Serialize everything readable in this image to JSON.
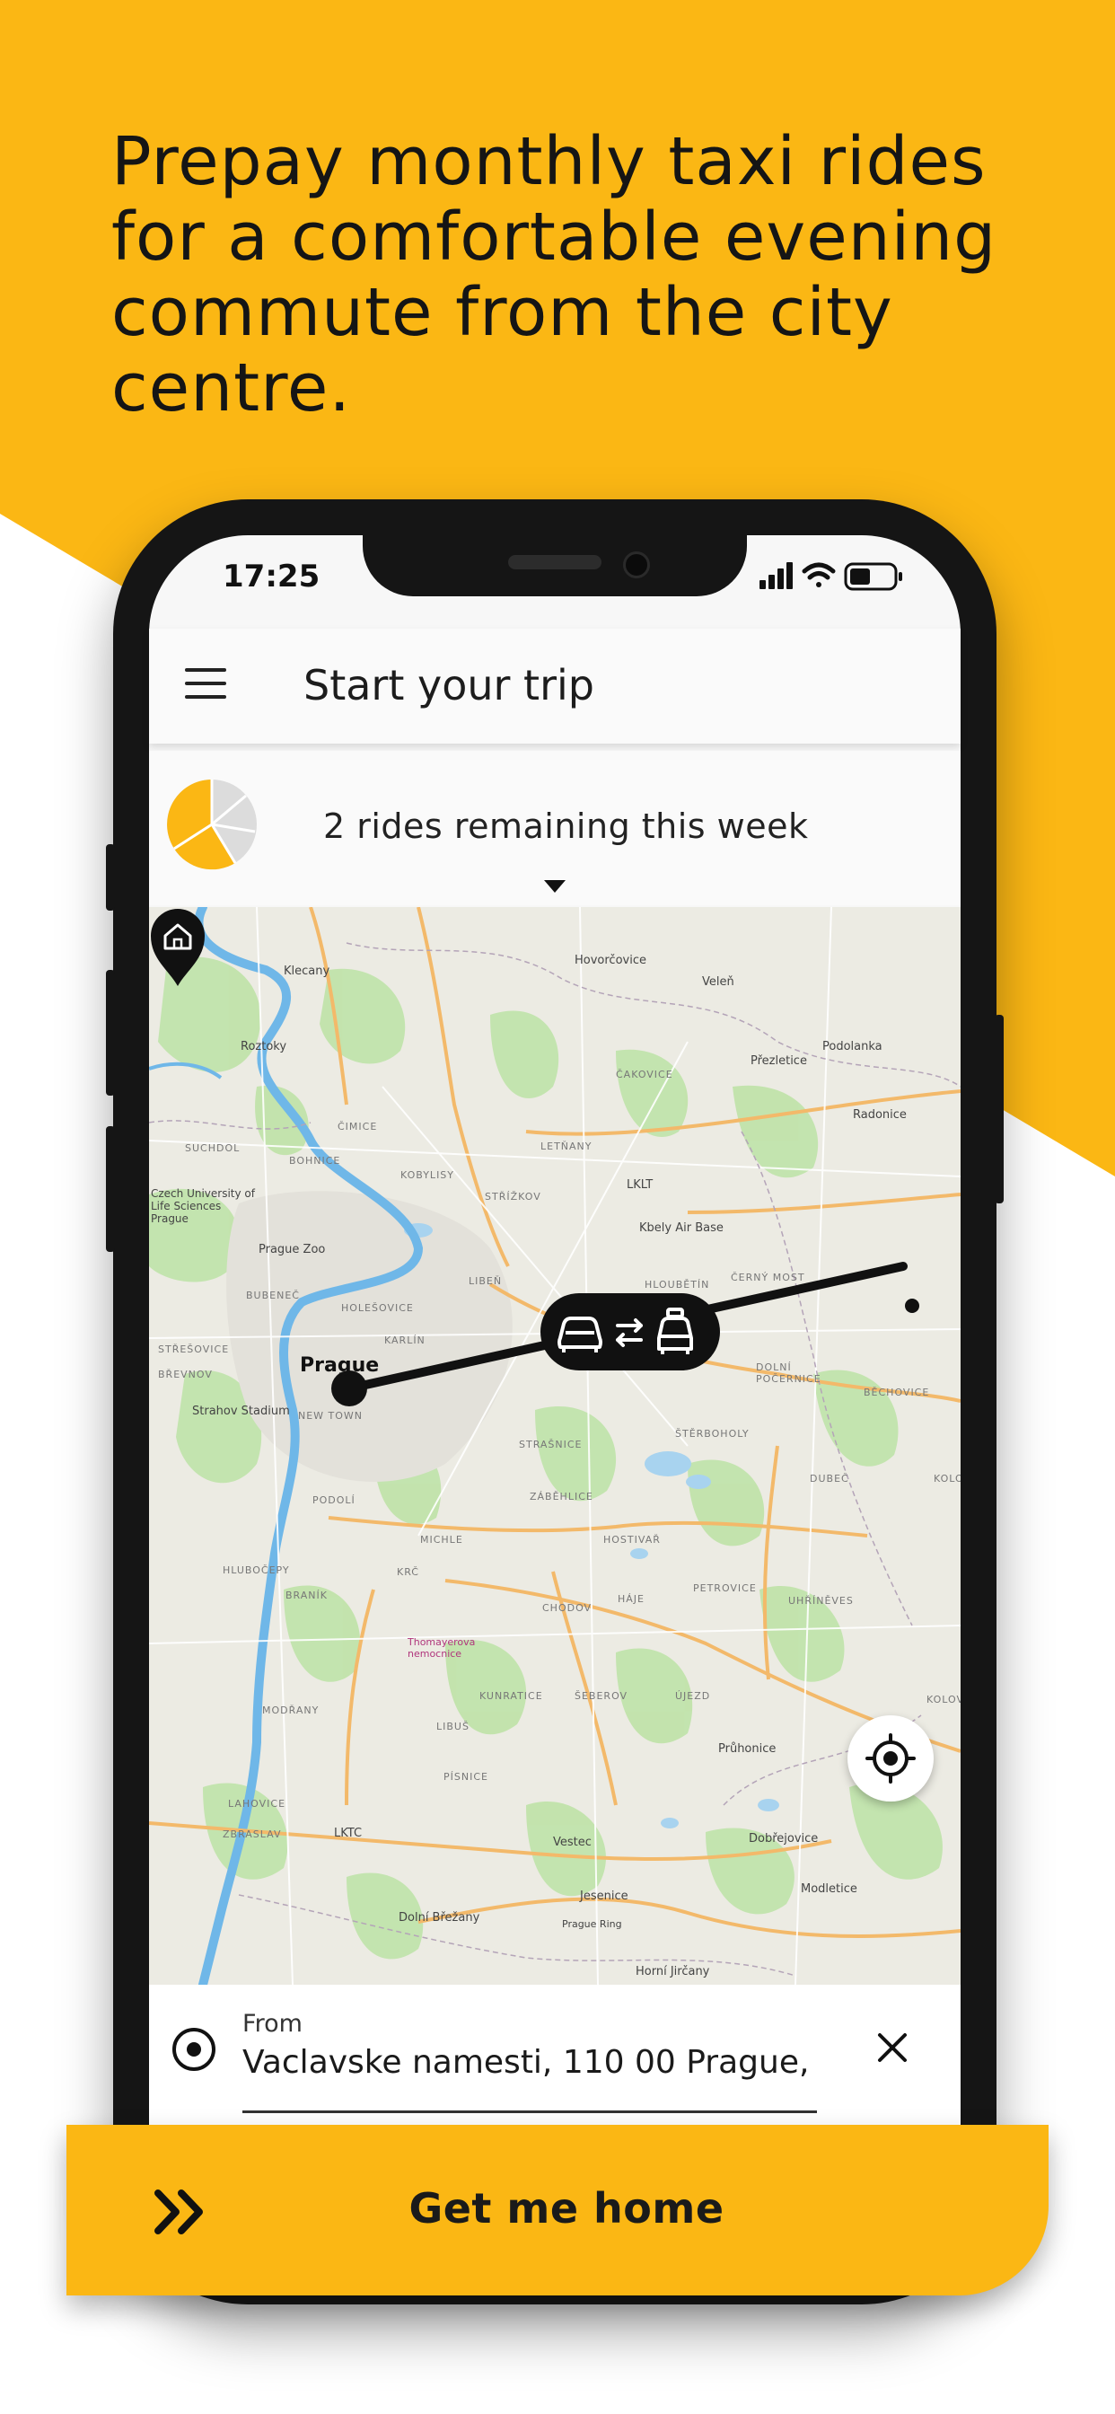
{
  "promo": {
    "headline": "Prepay monthly taxi rides for a comfortable evening commute from the city centre.",
    "background_color": "#fbb714"
  },
  "status_bar": {
    "time": "17:25",
    "icons": [
      "cellular-signal-icon",
      "wifi-icon",
      "battery-icon"
    ]
  },
  "header": {
    "menu_icon": "hamburger-menu-icon",
    "title": "Start your trip"
  },
  "rides": {
    "text": "2 rides remaining this week",
    "remaining_fraction": 0.4,
    "accent_color": "#fbb714"
  },
  "map": {
    "city_label": "Prague",
    "labels": {
      "klecany": "Klecany",
      "hovorcovice": "Hovorčovice",
      "velen": "Veleň",
      "roztoky": "Roztoky",
      "podolanka": "Podolanka",
      "prezletice": "Přezletice",
      "radonice": "Radonice",
      "cakovice": "ČAKOVICE",
      "cimice": "ČIMICE",
      "letnany": "LETŇANY",
      "bohnice": "BOHNICE",
      "suchdol": "SUCHDOL",
      "kobylisy": "KOBYLISY",
      "strizkov": "STŘÍŽKOV",
      "lklt": "LKLT",
      "czu": "Czech University of Life Sciences Prague",
      "kbely": "Kbely Air Base",
      "prague_zoo": "Prague Zoo",
      "bubenec": "BUBENEČ",
      "holesovice": "HOLEŠOVICE",
      "liben": "LIBEŇ",
      "hloubetin": "HLOUBĚTÍN",
      "cerny_most": "ČERNÝ MOST",
      "karlin": "KARLÍN",
      "strešovice": "STŘEŠOVICE",
      "brevnov": "BŘEVNOV",
      "strahov": "Strahov Stadium",
      "new_town": "NEW TOWN",
      "dolni_pocernice": "DOLNÍ POČERNICE",
      "bechovice": "BĚCHOVICE",
      "strasnice": "STRAŠNICE",
      "sterboholy": "ŠTĚRBOHOLY",
      "zabehlice": "ZÁBĚHLICE",
      "dubec": "DUBEČ",
      "kolodeje": "KOLODĚJE",
      "podoli": "PODOLÍ",
      "michle": "MICHLE",
      "hostivar": "HOSTIVAŘ",
      "petrovice": "PETROVICE",
      "uhrineves": "UHŘÍNĚVES",
      "hlubocepy": "HLUBOČEPY",
      "branik": "BRANÍK",
      "krc": "KRČ",
      "chodov": "CHODOV",
      "haje": "HÁJE",
      "thomayer": "Thomayerova nemocnice",
      "modrany": "MODŘANY",
      "kunratice": "KUNRATICE",
      "sebrov": "ŠEBEROV",
      "ujezd": "ÚJEZD",
      "kolovraty": "KOLOVRATY",
      "libus": "LIBUŠ",
      "pisnice": "PÍSNICE",
      "pruhonice": "Průhonice",
      "lahovice": "LAHOVICE",
      "zbraslav": "ZBRASLAV",
      "lktc": "LKTC",
      "vestec": "Vestec",
      "dobrejovice": "Dobřejovice",
      "jesenice": "Jesenice",
      "modletice": "Modletice",
      "dolni_brezany": "Dolní Břežany",
      "horni_jircany": "Horní Jirčany",
      "prague_ring": "Prague Ring"
    },
    "pill_icons": [
      "taxi-front-icon",
      "swap-arrows-icon",
      "taxi-icon"
    ],
    "home_icon": "home-icon",
    "locate_icon": "crosshair-locate-icon"
  },
  "from_field": {
    "label": "From",
    "value": "Vaclavske namesti, 110 00 Prague,",
    "origin_icon": "origin-dot-icon",
    "clear_icon": "close-icon"
  },
  "cta": {
    "label": "Get me home",
    "icon": "double-chevron-right-icon",
    "color": "#fbb714"
  }
}
